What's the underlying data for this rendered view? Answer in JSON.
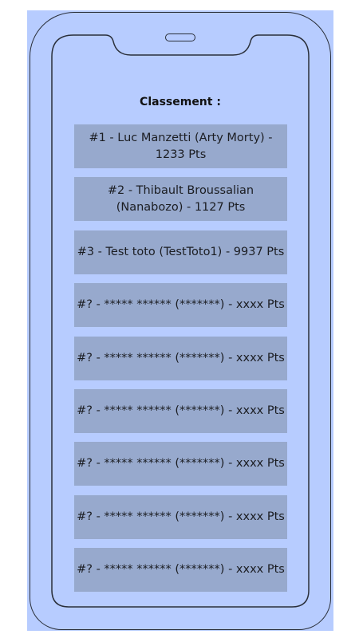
{
  "page": {
    "title": "Classement :"
  },
  "leaderboard": {
    "entries": [
      {
        "text": "#1 - Luc Manzetti (Arty Morty) - 1233 Pts"
      },
      {
        "text": "#2 - Thibault Broussalian (Nanabozo) - 1127 Pts"
      },
      {
        "text": "#3 - Test toto (TestToto1) - 9937 Pts"
      },
      {
        "text": "#? - ***** ****** (*******) - xxxx Pts"
      },
      {
        "text": "#? - ***** ****** (*******) - xxxx Pts"
      },
      {
        "text": "#? - ***** ****** (*******) - xxxx Pts"
      },
      {
        "text": "#? - ***** ****** (*******) - xxxx Pts"
      },
      {
        "text": "#? - ***** ****** (*******) - xxxx Pts"
      },
      {
        "text": "#? - ***** ****** (*******) - xxxx Pts"
      }
    ]
  },
  "colors": {
    "background": "#b7ccff",
    "row": "#97a9cd",
    "outline": "#2a2f3a"
  }
}
